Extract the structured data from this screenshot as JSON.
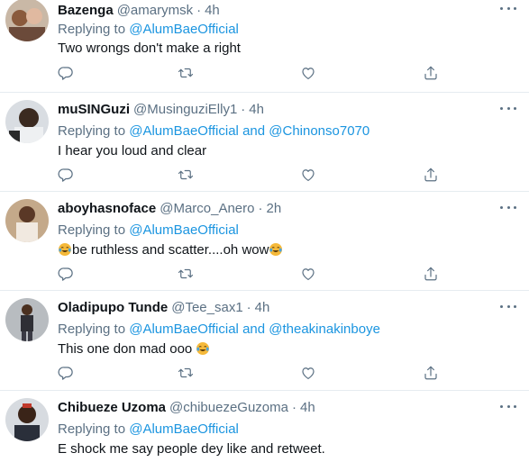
{
  "replying_label": "Replying to",
  "and_label": "and",
  "tweets": [
    {
      "name": "Bazenga",
      "handle": "@amarymsk",
      "dot": "·",
      "time": "4h",
      "reply_to_1": "@AlumBaeOfficial",
      "text": "Two wrongs don't make a right"
    },
    {
      "name": "muSINGuzi",
      "handle": "@MusinguziElly1",
      "dot": "·",
      "time": "4h",
      "reply_to_1": "@AlumBaeOfficial",
      "reply_to_2": "@Chinonso7070",
      "text": "I hear you loud and clear"
    },
    {
      "name": "aboyhasnoface",
      "handle": "@Marco_Anero",
      "dot": "·",
      "time": "2h",
      "reply_to_1": "@AlumBaeOfficial",
      "text": "be ruthless and scatter....oh wow"
    },
    {
      "name": "Oladipupo Tunde",
      "handle": "@Tee_sax1",
      "dot": "·",
      "time": "4h",
      "reply_to_1": "@AlumBaeOfficial",
      "reply_to_2": "@theakinakinboye",
      "text": "This one don mad ooo"
    },
    {
      "name": "Chibueze Uzoma",
      "handle": "@chibuezeGuzoma",
      "dot": "·",
      "time": "4h",
      "reply_to_1": "@AlumBaeOfficial",
      "text": "E shock me say people dey like and retweet."
    }
  ],
  "icons": {
    "reply": "reply-icon",
    "retweet": "retweet-icon",
    "like": "heart-icon",
    "share": "share-icon",
    "more": "more-icon",
    "emoji": "tears-of-joy-emoji"
  },
  "colors": {
    "link": "#1b95e0",
    "secondary": "#5b7083",
    "divider": "#e6ecf0"
  }
}
